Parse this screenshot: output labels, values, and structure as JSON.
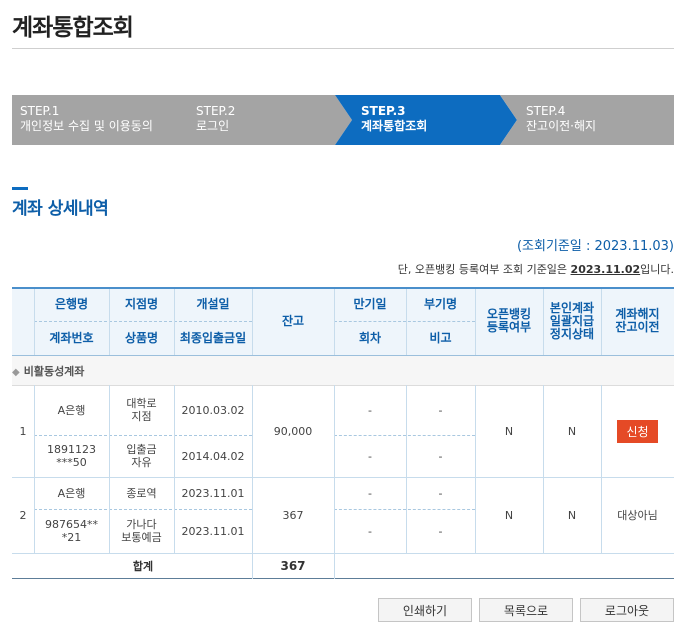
{
  "page": {
    "title": "계좌통합조회"
  },
  "steps": [
    {
      "title": "STEP.1",
      "desc": "개인정보 수집 및 이용동의"
    },
    {
      "title": "STEP.2",
      "desc": "로그인"
    },
    {
      "title": "STEP.3",
      "desc": "계좌통합조회"
    },
    {
      "title": "STEP.4",
      "desc": "잔고이전·해지"
    }
  ],
  "section": {
    "title": "계좌 상세내역",
    "inquiry_date": "(조회기준일 : 2023.11.03)",
    "note_prefix": "단, 오픈뱅킹 등록여부 조회 기준일은 ",
    "note_date": "2023.11.02",
    "note_suffix": "입니다."
  },
  "table": {
    "headers": {
      "bank": "은행명",
      "account_no": "계좌번호",
      "branch": "지점명",
      "product": "상품명",
      "open_date": "개설일",
      "last_txn": "최종입출금일",
      "balance": "잔고",
      "maturity": "만기일",
      "installment": "회차",
      "attachment": "부기명",
      "remark": "비고",
      "openbanking": "오픈뱅킹\n등록여부",
      "suspension": "본인계좌\n일괄지급\n정지상태",
      "close_transfer": "계좌해지\n잔고이전"
    },
    "group_label": "비활동성계좌",
    "rows": [
      {
        "no": "1",
        "bank": "A은행",
        "account_no": "1891123\n***50",
        "branch": "대학로\n지점",
        "product": "입출금\n자유",
        "open_date": "2010.03.02",
        "last_txn": "2014.04.02",
        "balance": "90,000",
        "maturity": "-",
        "installment": "-",
        "attachment": "-",
        "remark": "-",
        "openbanking": "N",
        "suspension": "N",
        "action": "신청"
      },
      {
        "no": "2",
        "bank": "A은행",
        "account_no": "987654**\n*21",
        "branch": "종로역",
        "product": "가나다\n보통예금",
        "open_date": "2023.11.01",
        "last_txn": "2023.11.01",
        "balance": "367",
        "maturity": "-",
        "installment": "-",
        "attachment": "-",
        "remark": "-",
        "openbanking": "N",
        "suspension": "N",
        "action": "대상아님"
      }
    ],
    "total_label": "합계",
    "total_value": "367"
  },
  "buttons": {
    "print": "인쇄하기",
    "list": "목록으로",
    "logout": "로그아웃"
  },
  "colors": {
    "accent": "#0d6cc0",
    "step_inactive": "#a4a4a4",
    "apply": "#e54a26"
  }
}
